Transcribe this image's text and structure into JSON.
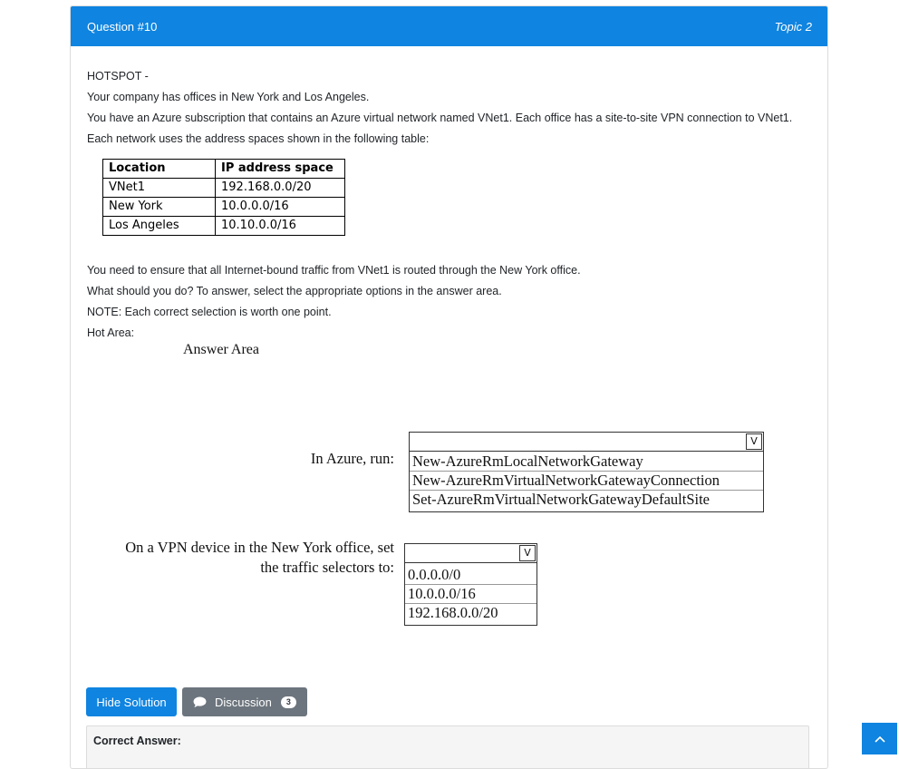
{
  "header": {
    "question": "Question #10",
    "topic": "Topic 2"
  },
  "question": {
    "lines": [
      "HOTSPOT -",
      "Your company has offices in New York and Los Angeles.",
      "You have an Azure subscription that contains an Azure virtual network named VNet1. Each office has a site-to-site VPN connection to VNet1.",
      "Each network uses the address spaces shown in the following table:"
    ],
    "table": {
      "headers": [
        "Location",
        "IP address space"
      ],
      "rows": [
        [
          "VNet1",
          "192.168.0.0/20"
        ],
        [
          "New York",
          "10.0.0.0/16"
        ],
        [
          "Los Angeles",
          "10.10.0.0/16"
        ]
      ]
    },
    "lines2": [
      "You need to ensure that all Internet-bound traffic from VNet1 is routed through the New York office.",
      "What should you do? To answer, select the appropriate options in the answer area.",
      "NOTE: Each correct selection is worth one point.",
      "Hot Area:"
    ]
  },
  "answer_area": {
    "title": "Answer Area",
    "q1_label": "In Azure, run:",
    "q1_options": [
      "New-AzureRmLocalNetworkGateway",
      "New-AzureRmVirtualNetworkGatewayConnection",
      "Set-AzureRmVirtualNetworkGatewayDefaultSite"
    ],
    "q2_label_line1": "On a VPN device in the New York office, set",
    "q2_label_line2": "the traffic selectors to:",
    "q2_options": [
      "0.0.0.0/0",
      "10.0.0.0/16",
      "192.168.0.0/20"
    ],
    "dropdown_chevron": "V"
  },
  "buttons": {
    "hide_solution": "Hide Solution",
    "discussion": "Discussion",
    "discussion_count": "3"
  },
  "correct_answer_label": "Correct Answer:",
  "colors": {
    "primary": "#0f84e0",
    "secondary": "#6c757d"
  }
}
